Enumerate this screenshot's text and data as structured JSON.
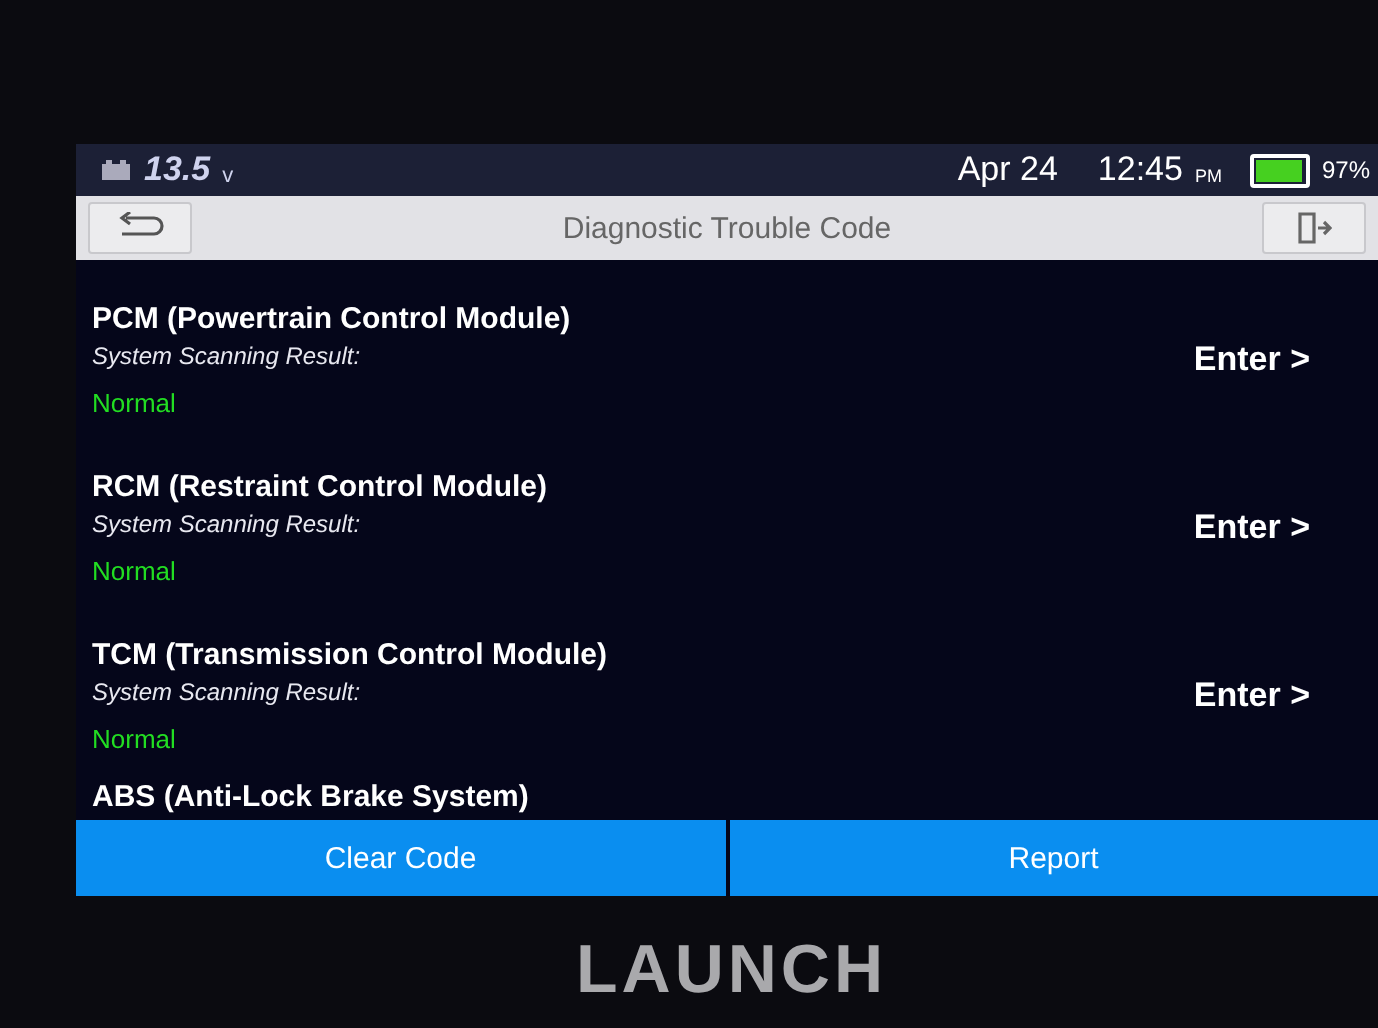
{
  "status_bar": {
    "voltage": "13.5",
    "voltage_unit": "v",
    "date": "Apr 24",
    "time": "12:45",
    "meridiem": "PM",
    "battery": {
      "level": 0.97
    },
    "battery_text": "97%"
  },
  "title_bar": {
    "title": "Diagnostic Trouble Code"
  },
  "modules": [
    {
      "name": "PCM (Powertrain Control Module)",
      "result_label": "System Scanning Result:",
      "result": "Normal",
      "action": "Enter >"
    },
    {
      "name": "RCM (Restraint Control Module)",
      "result_label": "System Scanning Result:",
      "result": "Normal",
      "action": "Enter >"
    },
    {
      "name": "TCM (Transmission Control Module)",
      "result_label": "System Scanning Result:",
      "result": "Normal",
      "action": "Enter >"
    },
    {
      "name": "ABS (Anti-Lock Brake System)"
    }
  ],
  "buttons": [
    "Clear Code",
    "Report"
  ],
  "brand": "LAUNCH"
}
